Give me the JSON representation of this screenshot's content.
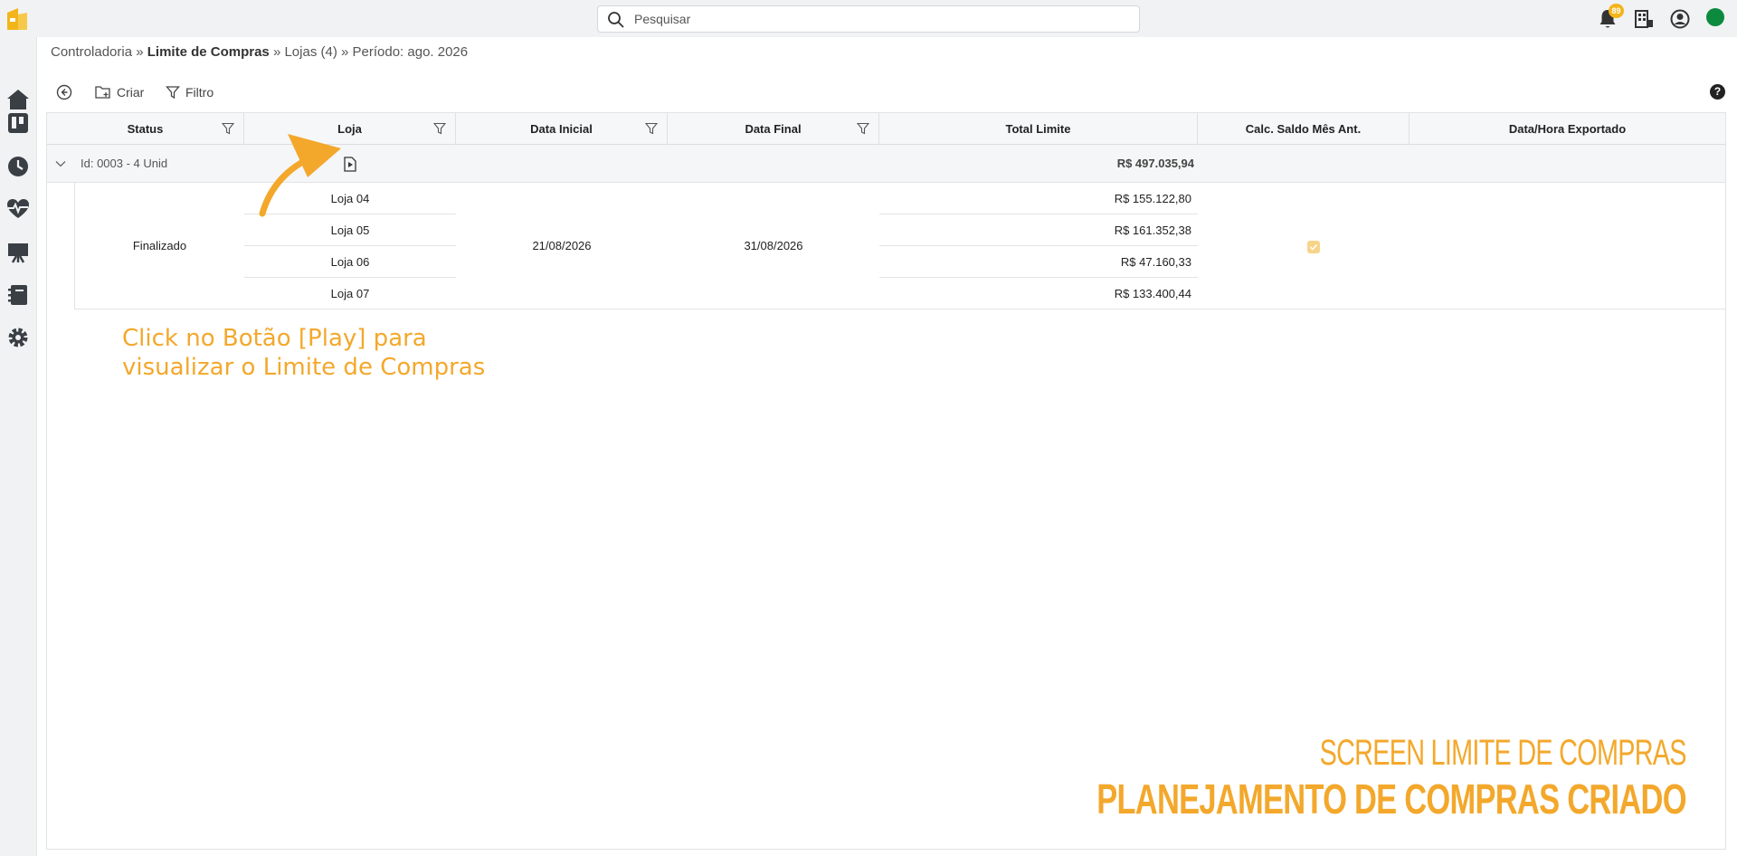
{
  "search": {
    "placeholder": "Pesquisar"
  },
  "notifications": {
    "count": "89"
  },
  "breadcrumb": {
    "part1": "Controladoria",
    "sep": " » ",
    "part2": "Limite de Compras",
    "part3": "Lojas (4)",
    "part4": "Período: ago. 2026"
  },
  "toolbar": {
    "create_label": "Criar",
    "filter_label": "Filtro",
    "help": "?"
  },
  "grid": {
    "columns": [
      "Status",
      "Loja",
      "Data Inicial",
      "Data Final",
      "Total Limite",
      "Calc. Saldo Mês Ant.",
      "Data/Hora Exportado"
    ],
    "group": {
      "label": "Id: 0003 - 4 Unid",
      "total": "R$ 497.035,94"
    },
    "status": "Finalizado",
    "data_inicial": "21/08/2026",
    "data_final": "31/08/2026",
    "calc_saldo_checked": true,
    "rows": [
      {
        "loja": "Loja 04",
        "total": "R$ 155.122,80"
      },
      {
        "loja": "Loja 05",
        "total": "R$ 161.352,38"
      },
      {
        "loja": "Loja 06",
        "total": "R$ 47.160,33"
      },
      {
        "loja": "Loja 07",
        "total": "R$ 133.400,44"
      }
    ]
  },
  "annotation": {
    "line1": "Click no Botão [Play] para",
    "line2": "visualizar o Limite de Compras"
  },
  "branding": {
    "subtitle": "SCREEN LIMITE DE COMPRAS",
    "title": "PLANEJAMENTO DE COMPRAS CRIADO"
  },
  "colors": {
    "accent": "#f3a82c",
    "badge": "#f3b51c",
    "status_online": "#0c8a3e"
  }
}
